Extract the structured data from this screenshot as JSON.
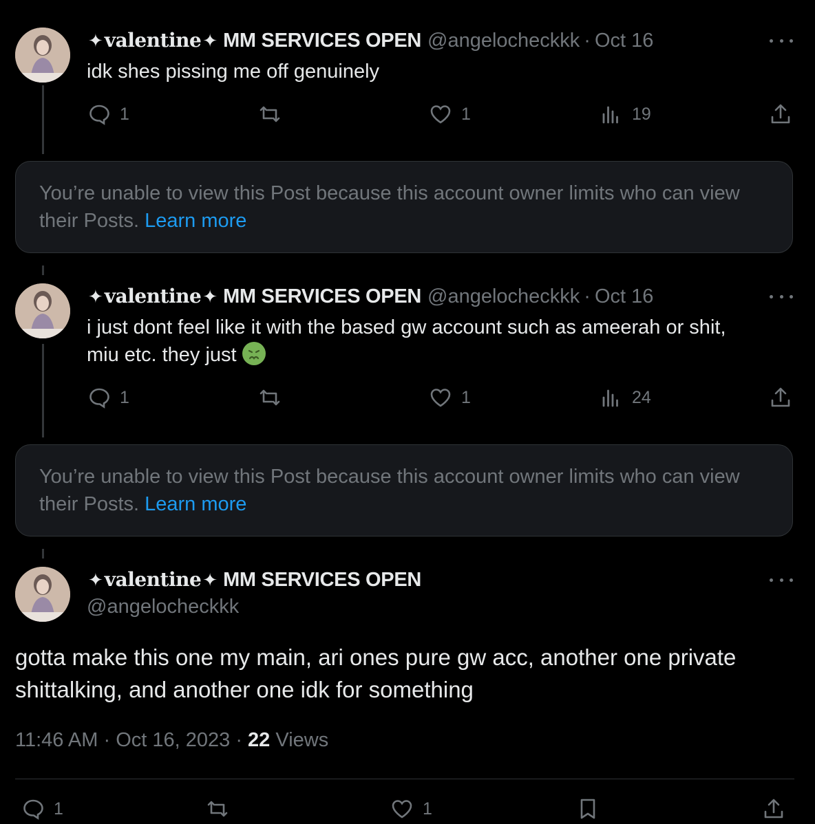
{
  "posts": [
    {
      "display_name_serif": "valentine",
      "display_name_bold": "MM SERVICES OPEN",
      "sparkle": "✦",
      "handle": "@angelocheckkk",
      "separator": "·",
      "date": "Oct 16",
      "text": "idk shes pissing me off genuinely",
      "replies": "1",
      "likes": "1",
      "views": "19"
    },
    {
      "display_name_serif": "valentine",
      "display_name_bold": "MM SERVICES OPEN",
      "sparkle": "✦",
      "handle": "@angelocheckkk",
      "separator": "·",
      "date": "Oct 16",
      "text_line1": "i just dont feel like it with the based gw account such as ameerah or shit,",
      "text_line2": "miu etc. they just",
      "emoji": "nauseated-face",
      "replies": "1",
      "likes": "1",
      "views": "24"
    }
  ],
  "restricted_notice": {
    "text": "You’re unable to view this Post because this account owner limits who can view their Posts.",
    "link": "Learn more"
  },
  "main_post": {
    "display_name_serif": "valentine",
    "display_name_bold": "MM SERVICES OPEN",
    "sparkle": "✦",
    "handle": "@angelocheckkk",
    "text": "gotta make this one my main, ari ones pure gw acc, another one private shittalking, and another one idk for something",
    "time": "11:46 AM",
    "date": "Oct 16, 2023",
    "separator": "·",
    "views_count": "22",
    "views_label": "Views",
    "replies": "1",
    "likes": "1"
  },
  "colors": {
    "background": "#000000",
    "text": "#e7e9ea",
    "muted": "#71767b",
    "link": "#1d9bf0",
    "card": "#16181c",
    "border": "#2f3336"
  }
}
